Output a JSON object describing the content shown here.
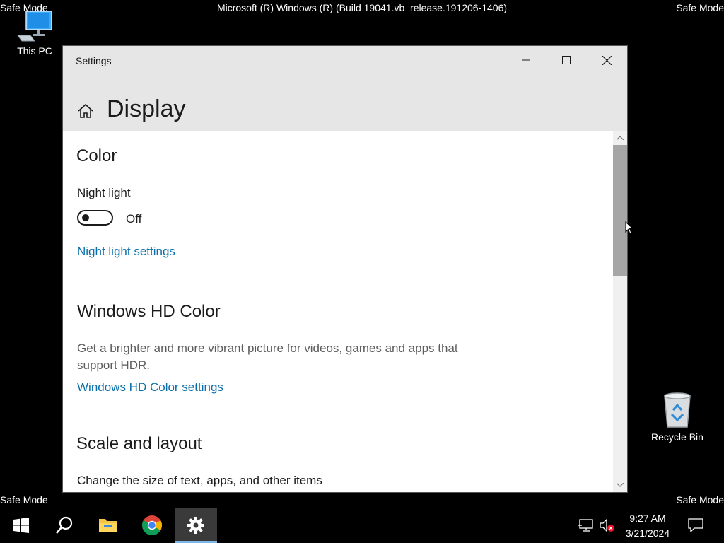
{
  "desktop": {
    "safe_mode_label": "Safe Mode",
    "build_text": "Microsoft (R) Windows (R) (Build 19041.vb_release.191206-1406)",
    "icons": [
      {
        "name": "this-pc",
        "label": "This PC",
        "icon": "computer-icon"
      },
      {
        "name": "recycle-bin",
        "label": "Recycle Bin",
        "icon": "recycle-bin-icon"
      }
    ]
  },
  "window": {
    "title": "Settings",
    "controls": [
      "minimize-icon",
      "maximize-icon",
      "close-icon"
    ],
    "page_title": "Display",
    "sections": {
      "color": {
        "heading": "Color",
        "night_light_label": "Night light",
        "night_light_state": "Off",
        "night_light_link": "Night light settings"
      },
      "hd_color": {
        "heading": "Windows HD Color",
        "description": "Get a brighter and more vibrant picture for videos, games and apps that support HDR.",
        "link": "Windows HD Color settings"
      },
      "scale": {
        "heading": "Scale and layout",
        "text": "Change the size of text, apps, and other items"
      }
    }
  },
  "taskbar": {
    "items": [
      "start-icon",
      "search-icon",
      "file-explorer-icon",
      "chrome-icon",
      "settings-icon"
    ],
    "active_item": "settings",
    "clock_time": "9:27 AM",
    "clock_date": "3/21/2024",
    "tray": [
      "network-icon",
      "volume-muted-icon",
      "action-center-icon"
    ]
  },
  "colors": {
    "link": "#0a6fa9",
    "window_header": "#e6e6e6",
    "active_indicator": "#7fb8e8"
  }
}
